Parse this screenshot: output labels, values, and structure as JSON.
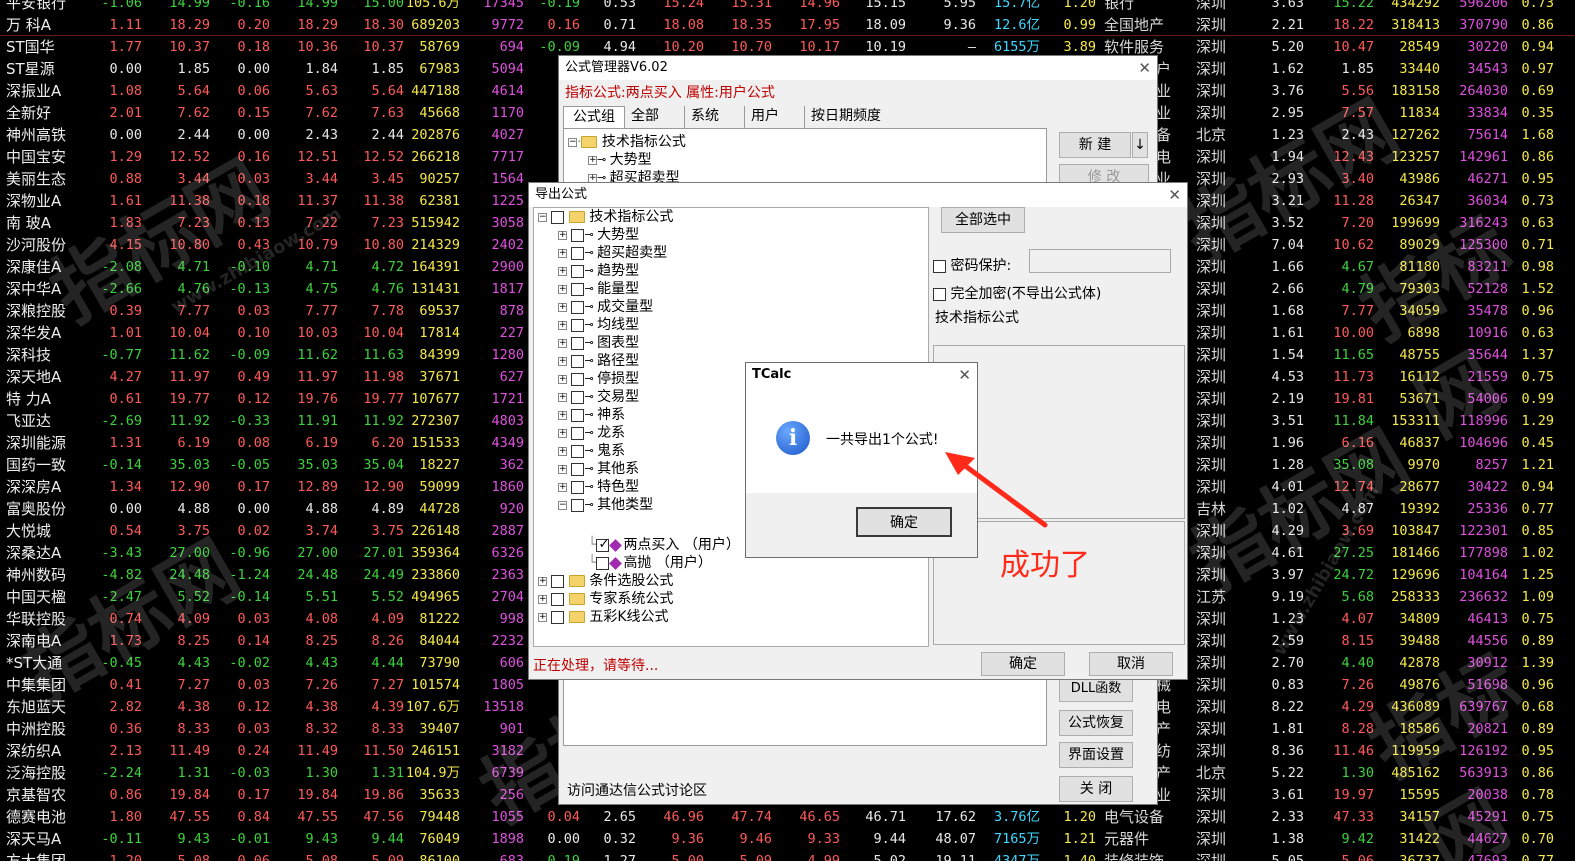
{
  "board": {
    "top_rows": [
      {
        "name": "平安银行",
        "chg": "-1.06",
        "price": "14.99",
        "d": "-0.16",
        "bid": "14.99",
        "ask": "15.00",
        "vol": "105.6万",
        "cur": "17345",
        "spd": "-0.19",
        "to": "0.53",
        "open": "15.24",
        "high": "15.31",
        "low": "14.96",
        "pre": "15.15",
        "pe": "5.95",
        "amt": "15.7亿",
        "vr": "1.20",
        "ind": "银行",
        "reg": "深圳",
        "a1": "3.63",
        "a2": "15.22",
        "a3": "434292",
        "a4": "596206",
        "a5": "0.73"
      },
      {
        "name": "万  科A",
        "chg": "1.11",
        "price": "18.29",
        "d": "0.20",
        "bid": "18.29",
        "ask": "18.30",
        "vol": "689203",
        "cur": "9772",
        "spd": "0.16",
        "to": "0.71",
        "open": "18.08",
        "high": "18.35",
        "low": "17.95",
        "pre": "18.09",
        "pe": "9.36",
        "amt": "12.6亿",
        "vr": "0.99",
        "ind": "全国地产",
        "reg": "深圳",
        "a1": "2.21",
        "a2": "18.22",
        "a3": "318413",
        "a4": "370790",
        "a5": "0.86"
      },
      {
        "name": "ST国华",
        "chg": "1.77",
        "price": "10.37",
        "d": "0.18",
        "bid": "10.36",
        "ask": "10.37",
        "vol": "58769",
        "cur": "694",
        "spd": "-0.09",
        "to": "4.94",
        "open": "10.20",
        "high": "10.70",
        "low": "10.17",
        "pre": "10.19",
        "pe": "—",
        "amt": "6155万",
        "vr": "3.89",
        "ind": "软件服务",
        "reg": "深圳",
        "a1": "5.20",
        "a2": "10.47",
        "a3": "28549",
        "a4": "30220",
        "a5": "0.94"
      }
    ],
    "left_rows": [
      {
        "name": "ST星源",
        "chg": "0.00",
        "price": "1.85",
        "d": "0.00",
        "bid": "1.84",
        "ask": "1.85",
        "vol": "67983",
        "cur": "5094"
      },
      {
        "name": "深振业A",
        "chg": "1.08",
        "price": "5.64",
        "d": "0.06",
        "bid": "5.63",
        "ask": "5.64",
        "vol": "447188",
        "cur": "4614"
      },
      {
        "name": "全新好",
        "chg": "2.01",
        "price": "7.62",
        "d": "0.15",
        "bid": "7.62",
        "ask": "7.63",
        "vol": "45668",
        "cur": "1170"
      },
      {
        "name": "神州高铁",
        "chg": "0.00",
        "price": "2.44",
        "d": "0.00",
        "bid": "2.43",
        "ask": "2.44",
        "vol": "202876",
        "cur": "4027"
      },
      {
        "name": "中国宝安",
        "chg": "1.29",
        "price": "12.52",
        "d": "0.16",
        "bid": "12.51",
        "ask": "12.52",
        "vol": "266218",
        "cur": "7717"
      },
      {
        "name": "美丽生态",
        "chg": "0.88",
        "price": "3.44",
        "d": "0.03",
        "bid": "3.44",
        "ask": "3.45",
        "vol": "90257",
        "cur": "1564"
      },
      {
        "name": "深物业A",
        "chg": "1.61",
        "price": "11.38",
        "d": "0.18",
        "bid": "11.37",
        "ask": "11.38",
        "vol": "62381",
        "cur": "1225"
      },
      {
        "name": "南  玻A",
        "chg": "1.83",
        "price": "7.23",
        "d": "0.13",
        "bid": "7.22",
        "ask": "7.23",
        "vol": "515942",
        "cur": "3058"
      },
      {
        "name": "沙河股份",
        "chg": "4.15",
        "price": "10.80",
        "d": "0.43",
        "bid": "10.79",
        "ask": "10.80",
        "vol": "214329",
        "cur": "2402"
      },
      {
        "name": "深康佳A",
        "chg": "-2.08",
        "price": "4.71",
        "d": "-0.10",
        "bid": "4.71",
        "ask": "4.72",
        "vol": "164391",
        "cur": "2900"
      },
      {
        "name": "深中华A",
        "chg": "-2.66",
        "price": "4.76",
        "d": "-0.13",
        "bid": "4.75",
        "ask": "4.76",
        "vol": "131431",
        "cur": "1817"
      },
      {
        "name": "深粮控股",
        "chg": "0.39",
        "price": "7.77",
        "d": "0.03",
        "bid": "7.77",
        "ask": "7.78",
        "vol": "69537",
        "cur": "878"
      },
      {
        "name": "深华发A",
        "chg": "1.01",
        "price": "10.04",
        "d": "0.10",
        "bid": "10.03",
        "ask": "10.04",
        "vol": "17814",
        "cur": "227"
      },
      {
        "name": "深科技",
        "chg": "-0.77",
        "price": "11.62",
        "d": "-0.09",
        "bid": "11.62",
        "ask": "11.63",
        "vol": "84399",
        "cur": "1280"
      },
      {
        "name": "深天地A",
        "chg": "4.27",
        "price": "11.97",
        "d": "0.49",
        "bid": "11.97",
        "ask": "11.98",
        "vol": "37671",
        "cur": "627"
      },
      {
        "name": "特  力A",
        "chg": "0.61",
        "price": "19.77",
        "d": "0.12",
        "bid": "19.76",
        "ask": "19.77",
        "vol": "107677",
        "cur": "1721"
      },
      {
        "name": "飞亚达",
        "chg": "-2.69",
        "price": "11.92",
        "d": "-0.33",
        "bid": "11.91",
        "ask": "11.92",
        "vol": "272307",
        "cur": "4803"
      },
      {
        "name": "深圳能源",
        "chg": "1.31",
        "price": "6.19",
        "d": "0.08",
        "bid": "6.19",
        "ask": "6.20",
        "vol": "151533",
        "cur": "4349"
      },
      {
        "name": "国药一致",
        "chg": "-0.14",
        "price": "35.03",
        "d": "-0.05",
        "bid": "35.03",
        "ask": "35.04",
        "vol": "18227",
        "cur": "362"
      },
      {
        "name": "深深房A",
        "chg": "1.34",
        "price": "12.90",
        "d": "0.17",
        "bid": "12.89",
        "ask": "12.90",
        "vol": "59099",
        "cur": "1860"
      },
      {
        "name": "富奥股份",
        "chg": "0.00",
        "price": "4.88",
        "d": "0.00",
        "bid": "4.88",
        "ask": "4.89",
        "vol": "44728",
        "cur": "920"
      },
      {
        "name": "大悦城",
        "chg": "0.54",
        "price": "3.75",
        "d": "0.02",
        "bid": "3.74",
        "ask": "3.75",
        "vol": "226148",
        "cur": "2887"
      },
      {
        "name": "深桑达A",
        "chg": "-3.43",
        "price": "27.00",
        "d": "-0.96",
        "bid": "27.00",
        "ask": "27.01",
        "vol": "359364",
        "cur": "6326"
      },
      {
        "name": "神州数码",
        "chg": "-4.82",
        "price": "24.48",
        "d": "-1.24",
        "bid": "24.48",
        "ask": "24.49",
        "vol": "233860",
        "cur": "2363"
      },
      {
        "name": "中国天楹",
        "chg": "-2.47",
        "price": "5.52",
        "d": "-0.14",
        "bid": "5.51",
        "ask": "5.52",
        "vol": "494965",
        "cur": "2704"
      },
      {
        "name": "华联控股",
        "chg": "0.74",
        "price": "4.09",
        "d": "0.03",
        "bid": "4.08",
        "ask": "4.09",
        "vol": "81222",
        "cur": "998"
      },
      {
        "name": "深南电A",
        "chg": "1.73",
        "price": "8.25",
        "d": "0.14",
        "bid": "8.25",
        "ask": "8.26",
        "vol": "84044",
        "cur": "2232"
      },
      {
        "name": "*ST大通",
        "chg": "-0.45",
        "price": "4.43",
        "d": "-0.02",
        "bid": "4.43",
        "ask": "4.44",
        "vol": "73790",
        "cur": "606"
      },
      {
        "name": "中集集团",
        "chg": "0.41",
        "price": "7.27",
        "d": "0.03",
        "bid": "7.26",
        "ask": "7.27",
        "vol": "101574",
        "cur": "1805"
      },
      {
        "name": "东旭蓝天",
        "chg": "2.82",
        "price": "4.38",
        "d": "0.12",
        "bid": "4.38",
        "ask": "4.39",
        "vol": "107.6万",
        "cur": "13518"
      },
      {
        "name": "中洲控股",
        "chg": "0.36",
        "price": "8.33",
        "d": "0.03",
        "bid": "8.32",
        "ask": "8.33",
        "vol": "39407",
        "cur": "901"
      },
      {
        "name": "深纺织A",
        "chg": "2.13",
        "price": "11.49",
        "d": "0.24",
        "bid": "11.49",
        "ask": "11.50",
        "vol": "246151",
        "cur": "3182"
      },
      {
        "name": "泛海控股",
        "chg": "-2.24",
        "price": "1.31",
        "d": "-0.03",
        "bid": "1.30",
        "ask": "1.31",
        "vol": "104.9万",
        "cur": "6739"
      },
      {
        "name": "京基智农",
        "chg": "0.86",
        "price": "19.84",
        "d": "0.17",
        "bid": "19.84",
        "ask": "19.86",
        "vol": "35633",
        "cur": "256"
      },
      {
        "name": "德赛电池",
        "chg": "1.80",
        "price": "47.55",
        "d": "0.84",
        "bid": "47.55",
        "ask": "47.56",
        "vol": "79448",
        "cur": "1055"
      },
      {
        "name": "深天马A",
        "chg": "-0.11",
        "price": "9.43",
        "d": "-0.01",
        "bid": "9.43",
        "ask": "9.44",
        "vol": "76049",
        "cur": "1898"
      },
      {
        "name": "方大集团",
        "chg": "1.20",
        "price": "5.08",
        "d": "0.06",
        "bid": "5.08",
        "ask": "5.09",
        "vol": "86100",
        "cur": "683"
      }
    ],
    "right_rows": [
      {
        "reg": "深圳",
        "a1": "1.62",
        "a2": "1.85",
        "a3": "33440",
        "a4": "34543",
        "a5": "0.97"
      },
      {
        "reg": "深圳",
        "a1": "3.76",
        "a2": "5.56",
        "a3": "183158",
        "a4": "264030",
        "a5": "0.69"
      },
      {
        "reg": "深圳",
        "a1": "2.95",
        "a2": "7.57",
        "a3": "11834",
        "a4": "33834",
        "a5": "0.35"
      },
      {
        "reg": "北京",
        "a1": "1.23",
        "a2": "2.43",
        "a3": "127262",
        "a4": "75614",
        "a5": "1.68"
      },
      {
        "reg": "深圳",
        "a1": "1.94",
        "a2": "12.43",
        "a3": "123257",
        "a4": "142961",
        "a5": "0.86"
      },
      {
        "reg": "深圳",
        "a1": "2.93",
        "a2": "3.40",
        "a3": "43986",
        "a4": "46271",
        "a5": "0.95"
      },
      {
        "reg": "深圳",
        "a1": "3.21",
        "a2": "11.28",
        "a3": "26347",
        "a4": "36034",
        "a5": "0.73"
      },
      {
        "reg": "深圳",
        "a1": "3.52",
        "a2": "7.20",
        "a3": "199699",
        "a4": "316243",
        "a5": "0.63"
      },
      {
        "reg": "深圳",
        "a1": "7.04",
        "a2": "10.62",
        "a3": "89029",
        "a4": "125300",
        "a5": "0.71"
      },
      {
        "reg": "深圳",
        "a1": "1.66",
        "a2": "4.67",
        "a3": "81180",
        "a4": "83211",
        "a5": "0.98"
      },
      {
        "reg": "深圳",
        "a1": "2.66",
        "a2": "4.79",
        "a3": "79303",
        "a4": "52128",
        "a5": "1.52"
      },
      {
        "reg": "深圳",
        "a1": "1.68",
        "a2": "7.77",
        "a3": "34059",
        "a4": "35478",
        "a5": "0.96"
      },
      {
        "reg": "深圳",
        "a1": "1.61",
        "a2": "10.00",
        "a3": "6898",
        "a4": "10916",
        "a5": "0.63"
      },
      {
        "reg": "深圳",
        "a1": "1.54",
        "a2": "11.65",
        "a3": "48755",
        "a4": "35644",
        "a5": "1.37"
      },
      {
        "reg": "深圳",
        "a1": "4.53",
        "a2": "11.73",
        "a3": "16112",
        "a4": "21559",
        "a5": "0.75"
      },
      {
        "reg": "深圳",
        "a1": "2.19",
        "a2": "19.81",
        "a3": "53671",
        "a4": "54006",
        "a5": "0.99"
      },
      {
        "reg": "深圳",
        "a1": "3.51",
        "a2": "11.84",
        "a3": "153311",
        "a4": "118996",
        "a5": "1.29"
      },
      {
        "reg": "深圳",
        "a1": "1.96",
        "a2": "6.16",
        "a3": "46837",
        "a4": "104696",
        "a5": "0.45"
      },
      {
        "reg": "深圳",
        "a1": "1.28",
        "a2": "35.08",
        "a3": "9970",
        "a4": "8257",
        "a5": "1.21"
      },
      {
        "reg": "深圳",
        "a1": "4.01",
        "a2": "12.74",
        "a3": "28677",
        "a4": "30422",
        "a5": "0.94"
      },
      {
        "reg": "吉林",
        "a1": "1.02",
        "a2": "4.87",
        "a3": "19392",
        "a4": "25336",
        "a5": "0.77"
      },
      {
        "reg": "深圳",
        "a1": "4.29",
        "a2": "3.69",
        "a3": "103847",
        "a4": "122301",
        "a5": "0.85"
      },
      {
        "reg": "深圳",
        "a1": "4.61",
        "a2": "27.25",
        "a3": "181466",
        "a4": "177898",
        "a5": "1.02"
      },
      {
        "reg": "深圳",
        "a1": "3.97",
        "a2": "24.72",
        "a3": "129696",
        "a4": "104164",
        "a5": "1.25"
      },
      {
        "reg": "江苏",
        "a1": "9.19",
        "a2": "5.68",
        "a3": "258333",
        "a4": "236632",
        "a5": "1.09"
      },
      {
        "reg": "深圳",
        "a1": "1.23",
        "a2": "4.07",
        "a3": "34809",
        "a4": "46413",
        "a5": "0.75"
      },
      {
        "reg": "深圳",
        "a1": "2.59",
        "a2": "8.15",
        "a3": "39488",
        "a4": "44556",
        "a5": "0.89"
      },
      {
        "reg": "深圳",
        "a1": "2.70",
        "a2": "4.40",
        "a3": "42878",
        "a4": "30912",
        "a5": "1.39"
      },
      {
        "reg": "深圳",
        "a1": "0.83",
        "a2": "7.26",
        "a3": "49876",
        "a4": "51698",
        "a5": "0.96"
      },
      {
        "reg": "深圳",
        "a1": "8.22",
        "a2": "4.29",
        "a3": "436089",
        "a4": "639767",
        "a5": "0.68"
      },
      {
        "reg": "深圳",
        "a1": "1.81",
        "a2": "8.28",
        "a3": "18586",
        "a4": "20821",
        "a5": "0.89"
      },
      {
        "reg": "深圳",
        "a1": "8.36",
        "a2": "11.46",
        "a3": "119959",
        "a4": "126192",
        "a5": "0.95"
      },
      {
        "reg": "北京",
        "a1": "5.22",
        "a2": "1.30",
        "a3": "485162",
        "a4": "563913",
        "a5": "0.86"
      },
      {
        "reg": "深圳",
        "a1": "3.61",
        "a2": "19.97",
        "a3": "15595",
        "a4": "20038",
        "a5": "0.78"
      },
      {
        "reg": "深圳",
        "a1": "2.33",
        "a2": "47.33",
        "a3": "34157",
        "a4": "45291",
        "a5": "0.75"
      },
      {
        "reg": "深圳",
        "a1": "1.38",
        "a2": "9.42",
        "a3": "31422",
        "a4": "44627",
        "a5": "0.70"
      },
      {
        "reg": "深圳",
        "a1": "5.05",
        "a2": "5.06",
        "a3": "36737",
        "a4": "47693",
        "a5": "0.77"
      }
    ],
    "peek_rows": [
      {
        "spd": "0.04",
        "to": "2.65",
        "open": "46.96",
        "high": "47.74",
        "low": "46.65",
        "pre": "46.71",
        "pe": "17.62",
        "amt": "3.76亿",
        "vr": "1.20",
        "ind": "电气设备"
      },
      {
        "spd": "0.00",
        "to": "0.32",
        "open": "9.36",
        "high": "9.46",
        "low": "9.33",
        "pre": "9.44",
        "pe": "48.07",
        "amt": "7165万",
        "vr": "1.21",
        "ind": "元器件"
      },
      {
        "spd": "-0.19",
        "to": "1.27",
        "open": "5.00",
        "high": "5.09",
        "low": "4.99",
        "pre": "5.02",
        "pe": "19.11",
        "amt": "4347万",
        "vr": "1.40",
        "ind": "装修装饰"
      }
    ],
    "industry_peeks": [
      "户",
      "业",
      "业",
      "备",
      "电",
      "业",
      "业",
      "业",
      "业",
      "电",
      "电",
      "电",
      "电",
      "电",
      "电",
      "电",
      "业",
      "力",
      "药",
      "地",
      "件",
      "产",
      "电",
      "电",
      "施",
      "产",
      "力",
      "业",
      "械",
      "电",
      "产",
      "纺",
      "产",
      "业"
    ],
    "watermark": "指标网",
    "watermark_url": "www.zhibiaow.com"
  },
  "formula_manager": {
    "title": "公式管理器V6.02",
    "info": "指标公式:两点买入  属性:用户公式",
    "tabs": [
      "公式组",
      "全部",
      "系统",
      "用户",
      "按日期频度"
    ],
    "tree": [
      "技术指标公式",
      "大势型",
      "超买超卖型"
    ],
    "new_button": "新  建",
    "modify_button": "修  改",
    "dll_button": "DLL函数",
    "restore_button": "公式恢复",
    "ui_button": "界面设置",
    "close_button": "关  闭",
    "forum_link": "访问通达信公式讨论区"
  },
  "export_dialog": {
    "title": "导出公式",
    "select_all": "全部选中",
    "password_label": "密码保护:",
    "full_encrypt_label": "完全加密(不导出公式体)",
    "formula_type": "技术指标公式",
    "ok_button": "确定",
    "cancel_button": "取消",
    "status": "正在处理，请等待...",
    "tree_root": "技术指标公式",
    "tree_items": [
      "大势型",
      "超买超卖型",
      "趋势型",
      "能量型",
      "成交量型",
      "均线型",
      "图表型",
      "路径型",
      "停损型",
      "交易型",
      "神系",
      "龙系",
      "鬼系",
      "其他系",
      "特色型",
      "其他类型"
    ],
    "user_items": [
      {
        "label": "两点买入 （用户）",
        "checked": true
      },
      {
        "label": "高抛 （用户）",
        "checked": false
      }
    ],
    "other_roots": [
      "条件选股公式",
      "专家系统公式",
      "五彩K线公式"
    ]
  },
  "tcalc": {
    "title": "TCalc",
    "message": "一共导出1个公式!",
    "ok_button": "确定"
  },
  "annotation": {
    "text": "成功了",
    "color": "#ff2a1a"
  }
}
